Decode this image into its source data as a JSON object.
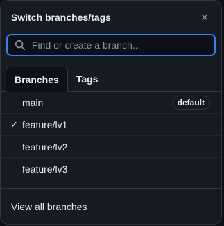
{
  "dialog": {
    "title": "Switch branches/tags",
    "close_icon": "close-icon"
  },
  "search": {
    "placeholder": "Find or create a branch...",
    "value": "",
    "icon": "search-icon"
  },
  "tabs": [
    {
      "label": "Branches",
      "active": true
    },
    {
      "label": "Tags",
      "active": false
    }
  ],
  "branches": [
    {
      "name": "main",
      "checked": false,
      "badge": "default"
    },
    {
      "name": "feature/lv1",
      "checked": true,
      "badge": ""
    },
    {
      "name": "feature/lv2",
      "checked": false,
      "badge": ""
    },
    {
      "name": "feature/lv3",
      "checked": false,
      "badge": ""
    }
  ],
  "footer": {
    "label": "View all branches"
  },
  "colors": {
    "accent": "#2f81f7",
    "panel_bg": "#161b22",
    "border": "#30363d",
    "text": "#e6edf3",
    "muted": "#8b949e"
  }
}
